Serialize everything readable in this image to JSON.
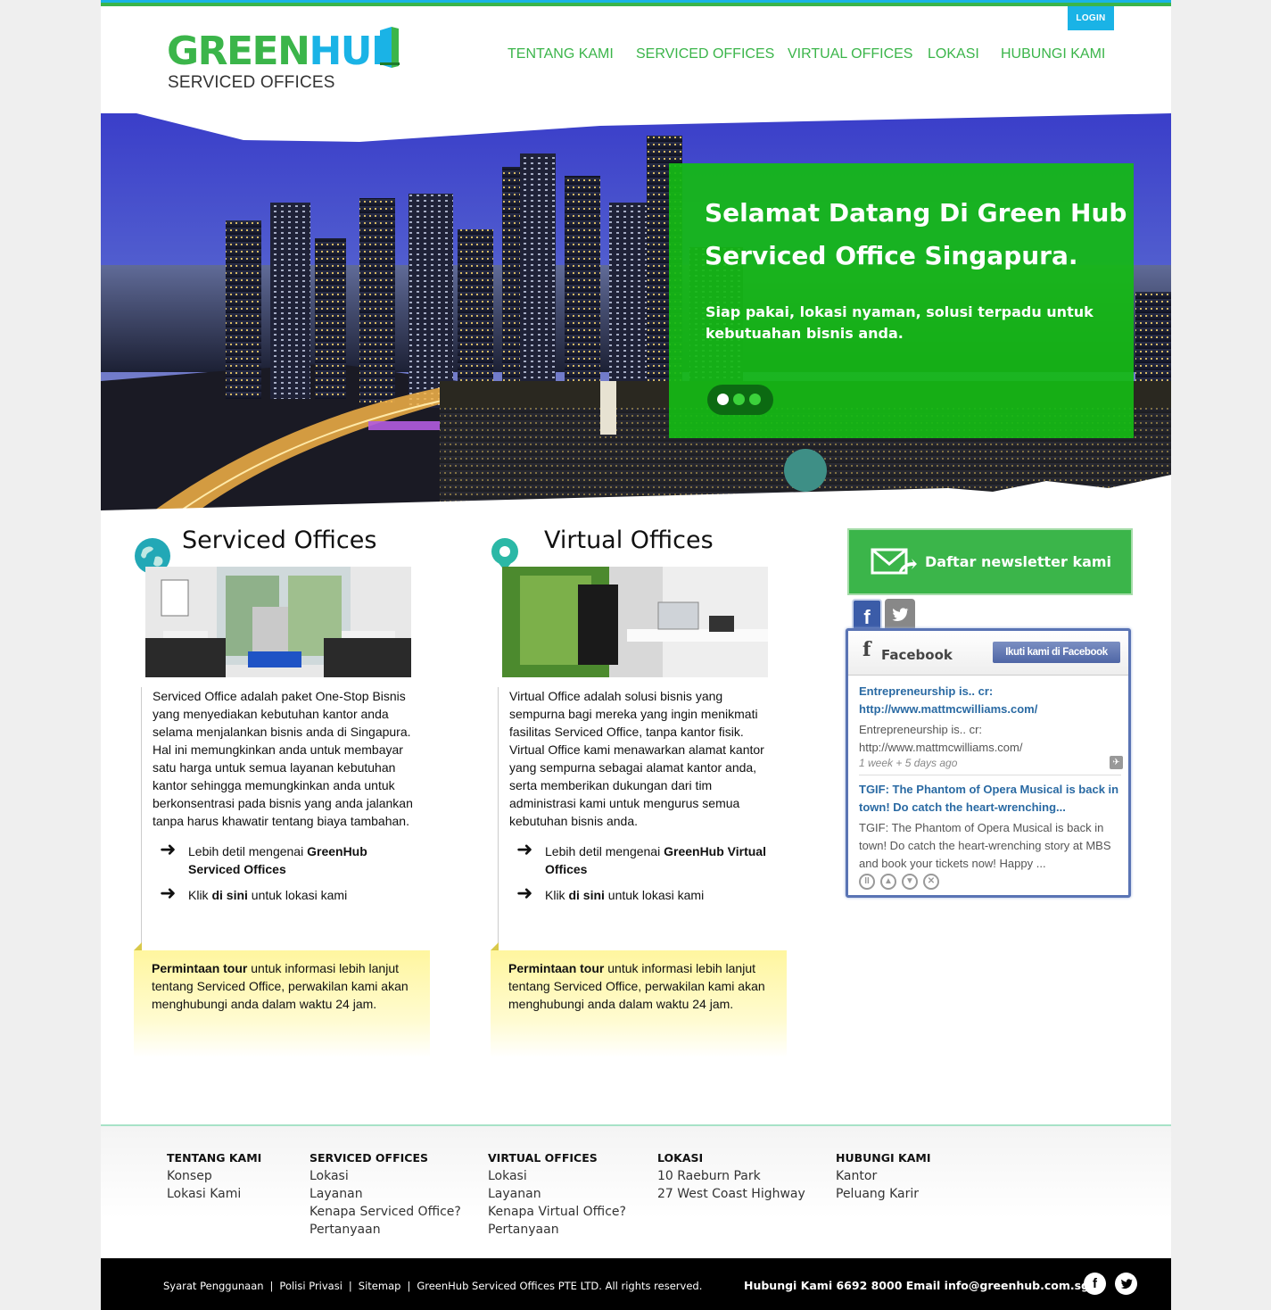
{
  "header": {
    "login_label": "LOGIN",
    "logo": {
      "green": "GREEN",
      "hub": "HUB",
      "subtitle": "SERVICED OFFICES"
    },
    "nav": [
      "TENTANG KAMI",
      "SERVICED OFFICES",
      "VIRTUAL OFFICES",
      "LOKASI",
      "HUBUNGI KAMI"
    ]
  },
  "hero": {
    "title": "Selamat Datang Di Green Hub Serviced Office Singapura.",
    "subtitle": "Siap pakai, lokasi nyaman,  solusi terpadu untuk kebutuahan bisnis anda.",
    "slides": 3,
    "active_slide": 1
  },
  "serviced": {
    "title": "Serviced Offices",
    "body": "Serviced Office adalah paket One-Stop Bisnis yang menyediakan kebutuhan kantor anda selama menjalankan bisnis anda di Singapura. Hal ini memungkinkan anda untuk membayar satu harga untuk semua layanan kebutuhan kantor sehingga memungkinkan anda untuk berkonsentrasi pada bisnis yang anda jalankan tanpa harus khawatir tentang biaya tambahan.",
    "link1_pre": "Lebih detil mengenai ",
    "link1_bold": "GreenHub Serviced Offices",
    "link2_pre": "Klik ",
    "link2_bold": "di sini",
    "link2_post": " untuk lokasi kami",
    "tour_bold": "Permintaan tour",
    "tour_rest": " untuk informasi lebih lanjut tentang Serviced Office, perwakilan kami akan menghubungi anda dalam waktu 24 jam."
  },
  "virtual": {
    "title": "Virtual Offices",
    "body": "Virtual Office adalah solusi bisnis yang sempurna bagi mereka yang ingin menikmati fasilitas Serviced Office, tanpa kantor fisik. Virtual Office kami menawarkan alamat kantor yang sempurna sebagai alamat kantor anda, serta memberikan dukungan dari tim administrasi kami untuk mengurus semua kebutuhan bisnis anda.",
    "link1_pre": "Lebih detil mengenai ",
    "link1_bold": "GreenHub Virtual Offices",
    "link2_pre": "Klik ",
    "link2_bold": "di sini",
    "link2_post": " untuk lokasi kami",
    "tour_bold": "Permintaan tour",
    "tour_rest": " untuk informasi lebih lanjut tentang Serviced Office, perwakilan kami akan menghubungi anda dalam waktu 24 jam."
  },
  "sidebar": {
    "newsletter_label": "Daftar newsletter kami",
    "fb_widget": {
      "title": "Facebook",
      "follow_button": "Ikuti kami di Facebook",
      "posts": [
        {
          "title": "Entrepreneurship is.. cr: http://www.mattmcwilliams.com/",
          "body": "Entrepreneurship is.. cr: http://www.mattmcwilliams.com/",
          "time": "1 week + 5 days ago"
        },
        {
          "title": "TGIF: The Phantom of Opera Musical is back in town! Do catch the heart-wrenching...",
          "body": "TGIF: The Phantom of Opera Musical is back in town! Do catch the heart-wrenching story at MBS and book your tickets now! Happy ...",
          "time": ""
        }
      ]
    }
  },
  "footer": {
    "columns": [
      {
        "heading": "TENTANG KAMI",
        "items": [
          "Konsep",
          "Lokasi Kami"
        ]
      },
      {
        "heading": "SERVICED OFFICES",
        "items": [
          "Lokasi",
          "Layanan",
          "Kenapa Serviced Office?",
          "Pertanyaan"
        ]
      },
      {
        "heading": "VIRTUAL OFFICES",
        "items": [
          "Lokasi",
          "Layanan",
          "Kenapa Virtual Office?",
          "Pertanyaan"
        ]
      },
      {
        "heading": "LOKASI",
        "items": [
          "10 Raeburn Park",
          "27 West Coast Highway"
        ]
      },
      {
        "heading": "HUBUNGI KAMI",
        "items": [
          "Kantor",
          "Peluang Karir"
        ]
      }
    ],
    "bottom": {
      "links": [
        "Syarat Penggunaan",
        "Polisi Privasi",
        "Sitemap"
      ],
      "copyright": "GreenHub Serviced Offices PTE LTD. All rights reserved.",
      "contact": "Hubungi Kami 6692 8000  Email info@greenhub.com.sg"
    }
  },
  "colors": {
    "brand_green": "#3bb54a",
    "brand_blue": "#1ab3e6",
    "hero_green": "#14b914"
  },
  "icons": [
    "globe-icon",
    "map-pin-icon",
    "envelope-icon",
    "facebook-icon",
    "twitter-icon",
    "arrow-right-icon"
  ]
}
